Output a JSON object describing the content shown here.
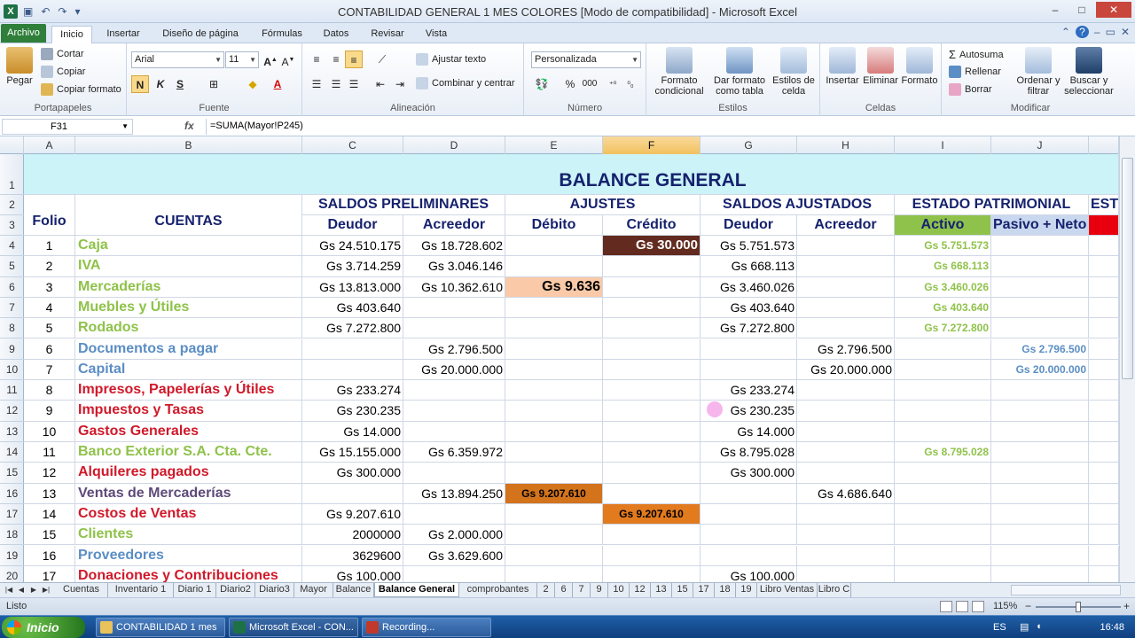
{
  "window": {
    "title": "CONTABILIDAD GENERAL 1 MES COLORES  [Modo de compatibilidad] - Microsoft Excel",
    "controls": [
      "–",
      "□",
      "✕"
    ]
  },
  "tabs": {
    "file": "Archivo",
    "items": [
      "Inicio",
      "Insertar",
      "Diseño de página",
      "Fórmulas",
      "Datos",
      "Revisar",
      "Vista"
    ]
  },
  "ribbon": {
    "clipboard": {
      "paste": "Pegar",
      "cut": "Cortar",
      "copy": "Copiar",
      "copy_format": "Copiar formato",
      "label": "Portapapeles"
    },
    "font": {
      "name": "Arial",
      "size": "11",
      "bold": "N",
      "italic": "K",
      "underline": "S",
      "label": "Fuente"
    },
    "alignment": {
      "wrap": "Ajustar texto",
      "merge": "Combinar y centrar",
      "label": "Alineación"
    },
    "number": {
      "format": "Personalizada",
      "percent": "%",
      "thousands": "000",
      "label": "Número"
    },
    "styles": {
      "conditional": "Formato condicional",
      "as_table": "Dar formato como tabla",
      "cell_styles": "Estilos de celda",
      "label": "Estilos"
    },
    "cells": {
      "insert": "Insertar",
      "delete": "Eliminar",
      "format": "Formato",
      "label": "Celdas"
    },
    "editing": {
      "autosum": "Autosuma",
      "fill": "Rellenar",
      "clear": "Borrar",
      "sort": "Ordenar y filtrar",
      "find": "Buscar y seleccionar",
      "label": "Modificar"
    }
  },
  "formula_bar": {
    "name_box": "F31",
    "fx": "fx",
    "formula": "=SUMA(Mayor!P245)"
  },
  "columns": [
    "A",
    "B",
    "C",
    "D",
    "E",
    "F",
    "G",
    "H",
    "I",
    "J"
  ],
  "rows": [
    "1",
    "2",
    "3",
    "4",
    "5",
    "6",
    "7",
    "8",
    "9",
    "10",
    "11",
    "12",
    "13",
    "14",
    "15",
    "16",
    "17",
    "18",
    "19",
    "20"
  ],
  "sheet": {
    "title": "BALANCE GENERAL",
    "group_headers": [
      "SALDOS PRELIMINARES",
      "AJUSTES",
      "SALDOS AJUSTADOS",
      "ESTADO PATRIMONIAL",
      "EST"
    ],
    "col_headers": [
      "Folio",
      "CUENTAS",
      "Deudor",
      "Acreedor",
      "Débito",
      "Crédito",
      "Deudor",
      "Acreedor",
      "Activo",
      "Pasivo + Neto"
    ],
    "data": [
      {
        "folio": "1",
        "cuenta": "Caja",
        "c": "Gs 24.510.175",
        "d": "Gs 18.728.602",
        "e": "",
        "f": "Gs 30.000",
        "g": "Gs 5.751.573",
        "h": "",
        "i": "Gs 5.751.573",
        "j": ""
      },
      {
        "folio": "2",
        "cuenta": "IVA",
        "c": "Gs 3.714.259",
        "d": "Gs 3.046.146",
        "e": "",
        "f": "",
        "g": "Gs 668.113",
        "h": "",
        "i": "Gs 668.113",
        "j": ""
      },
      {
        "folio": "3",
        "cuenta": "Mercaderías",
        "c": "Gs 13.813.000",
        "d": "Gs 10.362.610",
        "e": "Gs 9.636",
        "f": "",
        "g": "Gs 3.460.026",
        "h": "",
        "i": "Gs 3.460.026",
        "j": ""
      },
      {
        "folio": "4",
        "cuenta": "Muebles y Útiles",
        "c": "Gs 403.640",
        "d": "",
        "e": "",
        "f": "",
        "g": "Gs 403.640",
        "h": "",
        "i": "Gs 403.640",
        "j": ""
      },
      {
        "folio": "5",
        "cuenta": "Rodados",
        "c": "Gs 7.272.800",
        "d": "",
        "e": "",
        "f": "",
        "g": "Gs 7.272.800",
        "h": "",
        "i": "Gs 7.272.800",
        "j": ""
      },
      {
        "folio": "6",
        "cuenta": "Documentos a pagar",
        "c": "",
        "d": "Gs 2.796.500",
        "e": "",
        "f": "",
        "g": "",
        "h": "Gs 2.796.500",
        "i": "",
        "j": "Gs 2.796.500"
      },
      {
        "folio": "7",
        "cuenta": "Capital",
        "c": "",
        "d": "Gs 20.000.000",
        "e": "",
        "f": "",
        "g": "",
        "h": "Gs 20.000.000",
        "i": "",
        "j": "Gs 20.000.000"
      },
      {
        "folio": "8",
        "cuenta": "Impresos, Papelerías y Útiles",
        "c": "Gs 233.274",
        "d": "",
        "e": "",
        "f": "",
        "g": "Gs 233.274",
        "h": "",
        "i": "",
        "j": ""
      },
      {
        "folio": "9",
        "cuenta": "Impuestos y Tasas",
        "c": "Gs 230.235",
        "d": "",
        "e": "",
        "f": "",
        "g": "Gs 230.235",
        "h": "",
        "i": "",
        "j": ""
      },
      {
        "folio": "10",
        "cuenta": "Gastos Generales",
        "c": "Gs 14.000",
        "d": "",
        "e": "",
        "f": "",
        "g": "Gs 14.000",
        "h": "",
        "i": "",
        "j": ""
      },
      {
        "folio": "11",
        "cuenta": "Banco Exterior S.A. Cta. Cte.",
        "c": "Gs 15.155.000",
        "d": "Gs 6.359.972",
        "e": "",
        "f": "",
        "g": "Gs 8.795.028",
        "h": "",
        "i": "Gs 8.795.028",
        "j": ""
      },
      {
        "folio": "12",
        "cuenta": "Alquileres pagados",
        "c": "Gs 300.000",
        "d": "",
        "e": "",
        "f": "",
        "g": "Gs 300.000",
        "h": "",
        "i": "",
        "j": ""
      },
      {
        "folio": "13",
        "cuenta": "Ventas de Mercaderías",
        "c": "",
        "d": "Gs 13.894.250",
        "e": "Gs 9.207.610",
        "f": "",
        "g": "",
        "h": "Gs 4.686.640",
        "i": "",
        "j": ""
      },
      {
        "folio": "14",
        "cuenta": "Costos de Ventas",
        "c": "Gs 9.207.610",
        "d": "",
        "e": "",
        "f": "Gs 9.207.610",
        "g": "",
        "h": "",
        "i": "",
        "j": ""
      },
      {
        "folio": "15",
        "cuenta": "Clientes",
        "c": "2000000",
        "d": "Gs 2.000.000",
        "e": "",
        "f": "",
        "g": "",
        "h": "",
        "i": "",
        "j": ""
      },
      {
        "folio": "16",
        "cuenta": "Proveedores",
        "c": "3629600",
        "d": "Gs 3.629.600",
        "e": "",
        "f": "",
        "g": "",
        "h": "",
        "i": "",
        "j": ""
      },
      {
        "folio": "17",
        "cuenta": "Donaciones y Contribuciones",
        "c": "Gs 100.000",
        "d": "",
        "e": "",
        "f": "",
        "g": "Gs 100.000",
        "h": "",
        "i": "",
        "j": ""
      }
    ]
  },
  "sheet_tabs": [
    "Cuentas",
    "Inventario 1",
    "Diario 1",
    "Diario2",
    "Diario3",
    "Mayor",
    "Balance",
    "Balance General",
    "comprobantes",
    "2",
    "6",
    "7",
    "9",
    "10",
    "12",
    "13",
    "15",
    "17",
    "18",
    "19",
    "Libro Ventas",
    "Libro C"
  ],
  "active_sheet": "Balance General",
  "status": {
    "ready": "Listo",
    "zoom": "115%"
  },
  "taskbar": {
    "start": "Inicio",
    "items": [
      "CONTABILIDAD 1 mes",
      "Microsoft Excel - CON...",
      "Recording..."
    ],
    "lang": "ES",
    "clock": "16:48"
  },
  "colors": {
    "accent_green": "#8fc24a",
    "accent_blue": "#5b8ec4",
    "accent_red": "#d0192a",
    "title_navy": "#16226e"
  }
}
